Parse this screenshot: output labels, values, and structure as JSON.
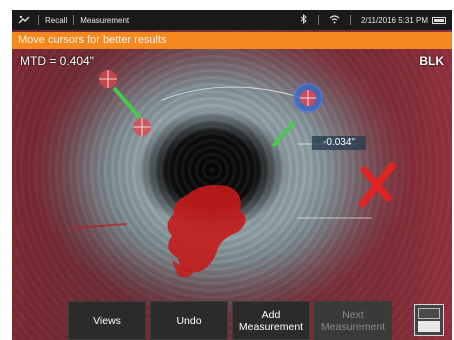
{
  "statusbar": {
    "app_icon": "probe-icon",
    "recall": "Recall",
    "screen": "Measurement",
    "datetime": "2/11/2016 5:31 PM",
    "icons": [
      "bluetooth-icon",
      "wifi-icon",
      "battery-icon"
    ]
  },
  "banner": {
    "text": "Move cursors for better results"
  },
  "measurement": {
    "mtd": "MTD = 0.404\"",
    "blk": "BLK",
    "readout": "-0.034\""
  },
  "colors": {
    "banner": "#f5891f",
    "cursor_red": "#e0464c",
    "cursor_blue": "#4a7ad8",
    "line_green": "#49c94f",
    "mask_red": "#c51b1b",
    "x_mark": "#e02424"
  },
  "toolbar": {
    "views": "Views",
    "undo": "Undo",
    "add_1": "Add",
    "add_2": "Measurement",
    "next_1": "Next",
    "next_2": "Measurement",
    "layout_icon": "screen-layout-icon"
  }
}
